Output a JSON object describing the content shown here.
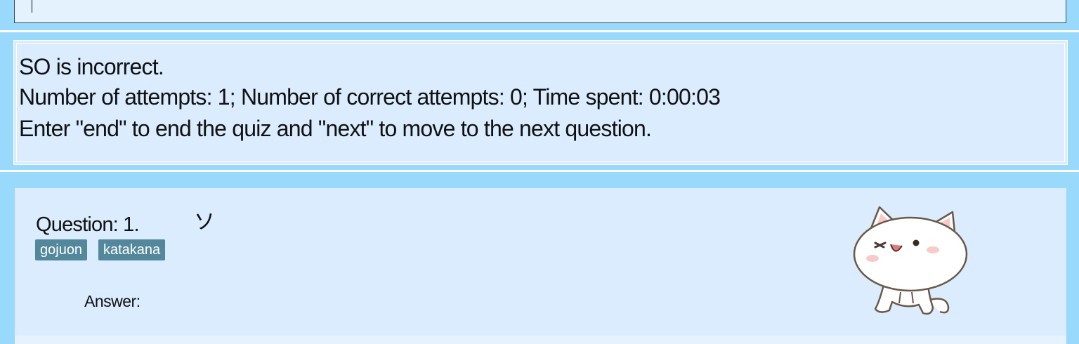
{
  "top_input": {
    "value": ""
  },
  "feedback": {
    "line1": "SO is incorrect.",
    "line2": "Number of attempts: 1; Number of correct attempts: 0; Time spent: 0:00:03",
    "line3": "Enter \"end\" to end the quiz and \"next\" to move to the next question."
  },
  "question": {
    "label": "Question: 1.",
    "character": "ソ",
    "tags": [
      "gojuon",
      "katakana"
    ],
    "answer_label": "Answer:",
    "illustration": "cat-sticker"
  },
  "colors": {
    "background": "#99d9fb",
    "panel": "#daecfd",
    "tag": "#53889c"
  }
}
